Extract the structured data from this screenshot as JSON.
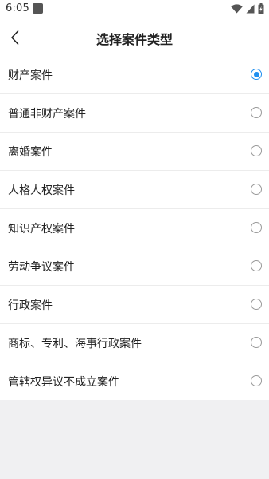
{
  "status_bar": {
    "time": "6:05",
    "icons": [
      "app-notification-icon",
      "wifi-icon",
      "signal-icon",
      "battery-charging-icon"
    ]
  },
  "header": {
    "back_icon": "chevron-left-icon",
    "title": "选择案件类型"
  },
  "case_types": {
    "selected_index": 0,
    "items": [
      {
        "label": "财产案件",
        "checked": true
      },
      {
        "label": "普通非财产案件",
        "checked": false
      },
      {
        "label": "离婚案件",
        "checked": false
      },
      {
        "label": "人格人权案件",
        "checked": false
      },
      {
        "label": "知识产权案件",
        "checked": false
      },
      {
        "label": "劳动争议案件",
        "checked": false
      },
      {
        "label": "行政案件",
        "checked": false
      },
      {
        "label": "商标、专利、海事行政案件",
        "checked": false
      },
      {
        "label": "管辖权异议不成立案件",
        "checked": false
      }
    ]
  },
  "colors": {
    "accent": "#1f8ff0",
    "background": "#f0f0f2",
    "surface": "#ffffff",
    "divider": "#ececec"
  }
}
